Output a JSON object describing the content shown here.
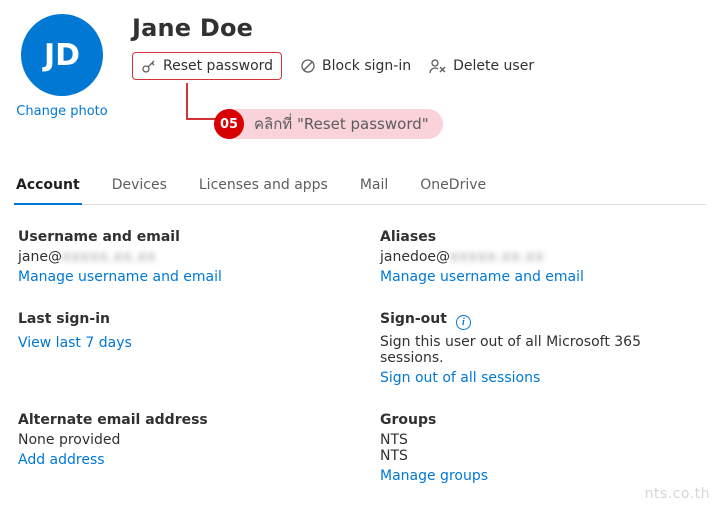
{
  "header": {
    "initials": "JD",
    "name": "Jane Doe",
    "change_photo": "Change photo",
    "actions": {
      "reset_password": "Reset password",
      "block_signin": "Block sign-in",
      "delete_user": "Delete user"
    }
  },
  "callout": {
    "badge": "05",
    "text": "คลิกที่ \"Reset password\""
  },
  "tabs": {
    "account": "Account",
    "devices": "Devices",
    "licenses": "Licenses and apps",
    "mail": "Mail",
    "onedrive": "OneDrive"
  },
  "fields": {
    "username_email": {
      "label": "Username and email",
      "value_prefix": "jane@",
      "value_suffix_blurred": "xxxxx.xx.xx",
      "link": "Manage username and email"
    },
    "aliases": {
      "label": "Aliases",
      "value_prefix": "janedoe@",
      "value_suffix_blurred": "xxxxx.xx.xx",
      "link": "Manage username and email"
    },
    "last_signin": {
      "label": "Last sign-in",
      "link": "View last 7 days"
    },
    "signout": {
      "label": "Sign-out",
      "desc": "Sign this user out of all Microsoft 365 sessions.",
      "link": "Sign out of all sessions"
    },
    "alt_email": {
      "label": "Alternate email address",
      "value": "None provided",
      "link": "Add address"
    },
    "groups": {
      "label": "Groups",
      "items": [
        "NTS",
        "NTS"
      ],
      "link": "Manage groups"
    }
  },
  "watermark": "nts.co.th"
}
